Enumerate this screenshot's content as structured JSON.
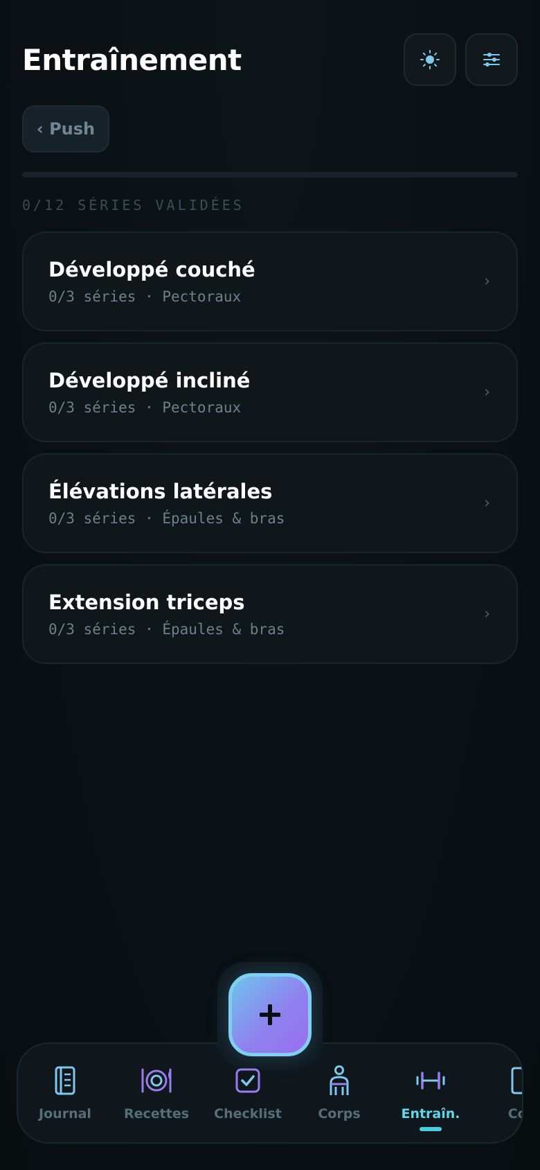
{
  "header": {
    "title": "Entraînement",
    "theme_icon": "sun-icon",
    "settings_icon": "sliders-icon"
  },
  "session": {
    "back_label": "‹ Push",
    "progress_fraction": 0,
    "progress_label": "0/12 SÉRIES VALIDÉES"
  },
  "exercises": [
    {
      "name": "Développé couché",
      "meta": "0/3 séries · Pectoraux"
    },
    {
      "name": "Développé incliné",
      "meta": "0/3 séries · Pectoraux"
    },
    {
      "name": "Élévations latérales",
      "meta": "0/3 séries · Épaules & bras"
    },
    {
      "name": "Extension triceps",
      "meta": "0/3 séries · Épaules & bras"
    }
  ],
  "chevron": "›",
  "fab": {
    "icon": "plus-icon",
    "symbol": "+"
  },
  "nav": {
    "items": [
      {
        "label": "Journal",
        "icon": "notebook-icon"
      },
      {
        "label": "Recettes",
        "icon": "plate-cutlery-icon"
      },
      {
        "label": "Checklist",
        "icon": "checkbox-icon"
      },
      {
        "label": "Corps",
        "icon": "person-icon"
      },
      {
        "label": "Entraîn.",
        "icon": "dumbbell-icon",
        "active": true
      },
      {
        "label": "Con",
        "icon": "book-icon"
      }
    ]
  },
  "colors": {
    "accent": "#5fd7e8",
    "fab_gradient_start": "#6fc4ee",
    "fab_gradient_end": "#9a6ef0",
    "background": "#0a1014"
  }
}
